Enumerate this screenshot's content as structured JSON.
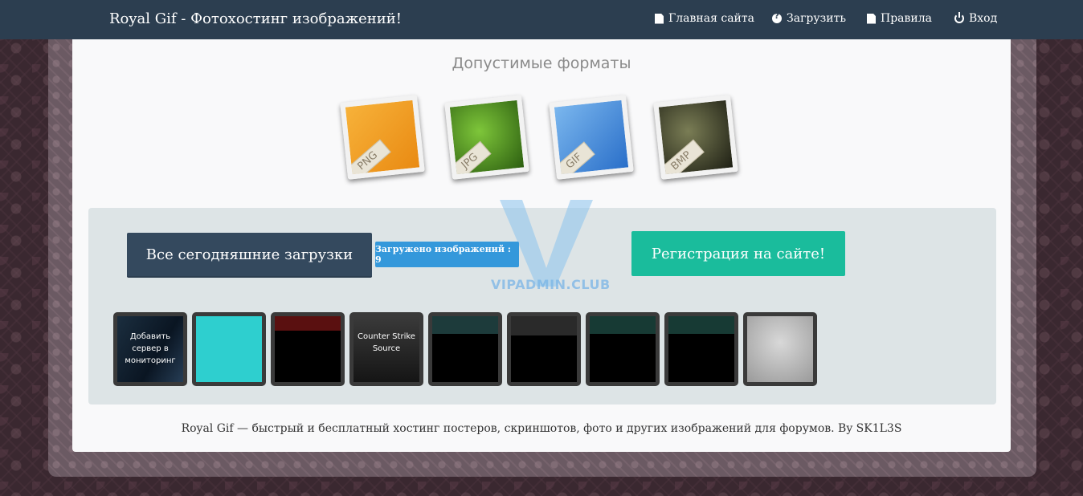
{
  "navbar": {
    "brand": "Royal Gif - Фотохостинг изображений!",
    "items": [
      {
        "label": "Главная сайта",
        "icon": "file-icon"
      },
      {
        "label": "Загрузить",
        "icon": "question-circle-icon"
      },
      {
        "label": "Правила",
        "icon": "file-icon"
      },
      {
        "label": "Вход",
        "icon": "power-icon"
      }
    ]
  },
  "formats": {
    "title": "Допустимые форматы",
    "items": [
      "PNG",
      "JPG",
      "GIF",
      "BMP"
    ]
  },
  "upload": {
    "today_button": "Все сегодняшние загрузки",
    "count_badge": "Загружено изображений : 9",
    "register_button": "Регистрация на сайте!",
    "watermark": "VIPADMIN.CLUB"
  },
  "thumbnails": [
    {
      "caption": "Добавить сервер в мониторинг"
    },
    {
      "caption": ""
    },
    {
      "caption": ""
    },
    {
      "caption": "Counter Strike Source"
    },
    {
      "caption": ""
    },
    {
      "caption": ""
    },
    {
      "caption": ""
    },
    {
      "caption": ""
    },
    {
      "caption": ""
    }
  ],
  "footer": {
    "text": "Royal Gif — быстрый и бесплатный хостинг постеров, скриншотов, фото и других изображений для форумов. By SK1L3S"
  },
  "colors": {
    "navbar": "#2c3e50",
    "today_button": "#34495e",
    "badge": "#3498db",
    "register_button": "#1abc9c"
  }
}
